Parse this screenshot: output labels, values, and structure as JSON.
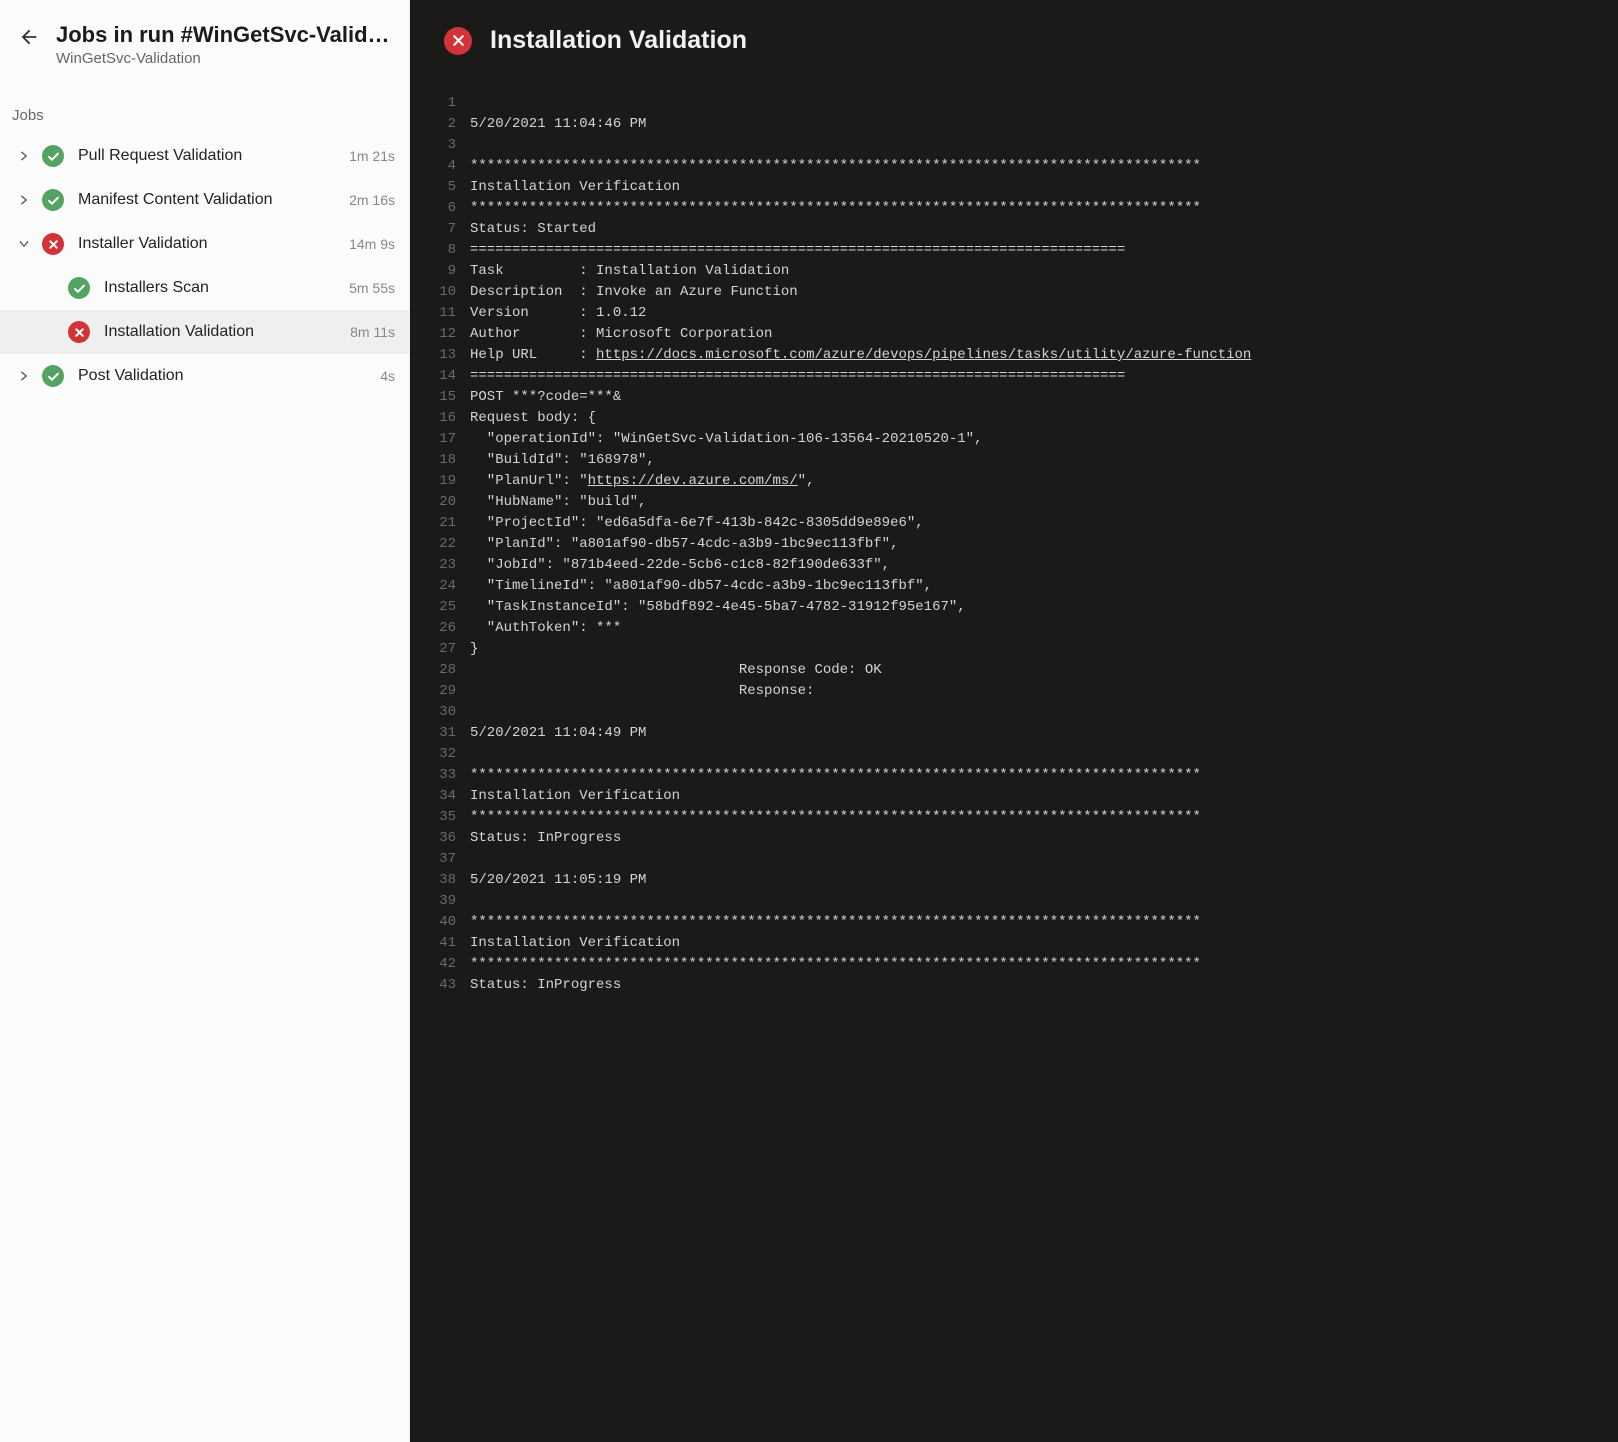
{
  "header": {
    "title": "Jobs in run #WinGetSvc-Valida…",
    "subtitle": "WinGetSvc-Validation"
  },
  "sections": {
    "jobs_label": "Jobs"
  },
  "jobs": [
    {
      "id": "pull-request-validation",
      "label": "Pull Request Validation",
      "status": "success",
      "duration": "1m 21s",
      "expanded": false,
      "children": []
    },
    {
      "id": "manifest-content-validation",
      "label": "Manifest Content Validation",
      "status": "success",
      "duration": "2m 16s",
      "expanded": false,
      "children": []
    },
    {
      "id": "installer-validation",
      "label": "Installer Validation",
      "status": "fail",
      "duration": "14m 9s",
      "expanded": true,
      "children": [
        {
          "id": "installers-scan",
          "label": "Installers Scan",
          "status": "success",
          "duration": "5m 55s",
          "selected": false
        },
        {
          "id": "installation-validation",
          "label": "Installation Validation",
          "status": "fail",
          "duration": "8m 11s",
          "selected": true
        }
      ]
    },
    {
      "id": "post-validation",
      "label": "Post Validation",
      "status": "success",
      "duration": "4s",
      "expanded": false,
      "children": []
    }
  ],
  "log": {
    "title": "Installation Validation",
    "status": "fail",
    "lines": [
      "",
      "5/20/2021 11:04:46 PM",
      "",
      "***************************************************************************************",
      "Installation Verification",
      "***************************************************************************************",
      "Status: Started",
      "==============================================================================",
      "Task         : Installation Validation",
      "Description  : Invoke an Azure Function",
      "Version      : 1.0.12",
      "Author       : Microsoft Corporation",
      {
        "prefix": "Help URL     : ",
        "link": "https://docs.microsoft.com/azure/devops/pipelines/tasks/utility/azure-function"
      },
      "==============================================================================",
      "POST ***?code=***&",
      "Request body: {",
      "  \"operationId\": \"WinGetSvc-Validation-106-13564-20210520-1\",",
      "  \"BuildId\": \"168978\",",
      {
        "prefix": "  \"PlanUrl\": \"",
        "link": "https://dev.azure.com/ms/",
        "suffix": "\","
      },
      "  \"HubName\": \"build\",",
      "  \"ProjectId\": \"ed6a5dfa-6e7f-413b-842c-8305dd9e89e6\",",
      "  \"PlanId\": \"a801af90-db57-4cdc-a3b9-1bc9ec113fbf\",",
      "  \"JobId\": \"871b4eed-22de-5cb6-c1c8-82f190de633f\",",
      "  \"TimelineId\": \"a801af90-db57-4cdc-a3b9-1bc9ec113fbf\",",
      "  \"TaskInstanceId\": \"58bdf892-4e45-5ba7-4782-31912f95e167\",",
      "  \"AuthToken\": ***",
      "}",
      "                                Response Code: OK",
      "                                Response:",
      "",
      "5/20/2021 11:04:49 PM",
      "",
      "***************************************************************************************",
      "Installation Verification",
      "***************************************************************************************",
      "Status: InProgress",
      "",
      "5/20/2021 11:05:19 PM",
      "",
      "***************************************************************************************",
      "Installation Verification",
      "***************************************************************************************",
      "Status: InProgress"
    ]
  }
}
